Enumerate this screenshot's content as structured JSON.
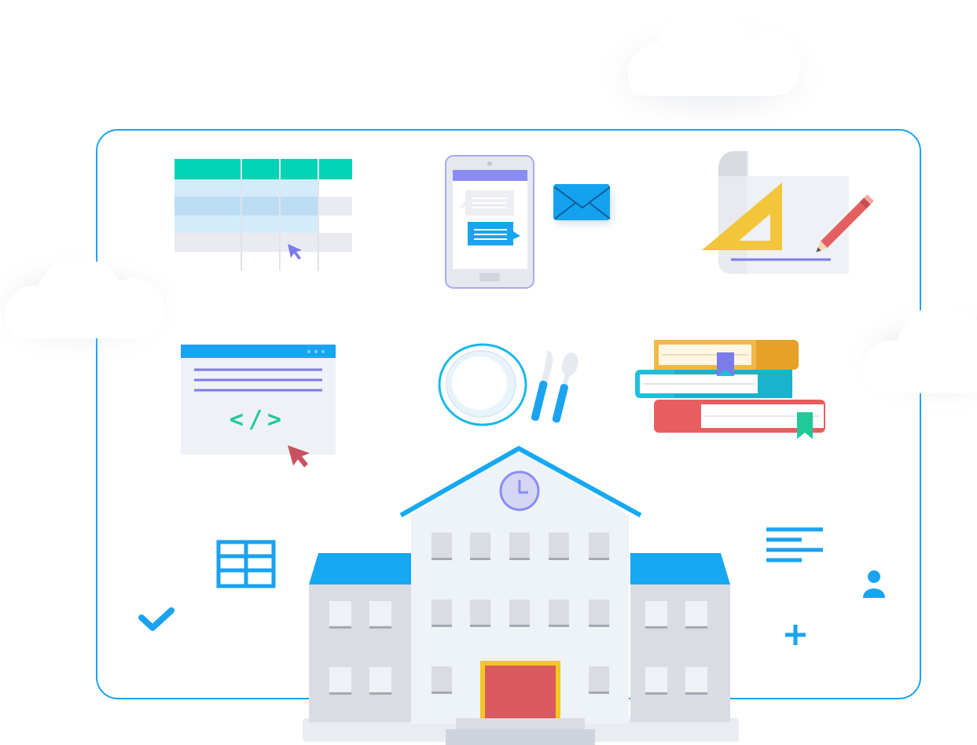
{
  "illustration": {
    "code_window_glyph": "</>",
    "colors": {
      "accent_blue": "#1aa3f0",
      "teal": "#00d4b4",
      "purple": "#7b7bea",
      "roof_blue": "#16a9f2",
      "door_red": "#d95a5e",
      "door_frame": "#f3c624",
      "wall_light": "#eef3f8",
      "wall_gray": "#d9dce3",
      "book_orange": "#e6a126",
      "book_cyan": "#1ec0dd",
      "book_red": "#e85d60",
      "ruler_yellow": "#f3c53a",
      "pencil_red": "#e46060",
      "code_green": "#20c997",
      "cursor_red": "#c9525e"
    },
    "icons": [
      "cloud-icon",
      "spreadsheet-icon",
      "tablet-chat-icon",
      "envelope-icon",
      "blueprint-ruler-pencil-icon",
      "code-window-icon",
      "plate-cutlery-icon",
      "books-stack-icon",
      "school-building-icon",
      "clock-icon",
      "table-grid-icon",
      "checkmark-icon",
      "text-align-icon",
      "user-icon",
      "plus-icon"
    ]
  }
}
